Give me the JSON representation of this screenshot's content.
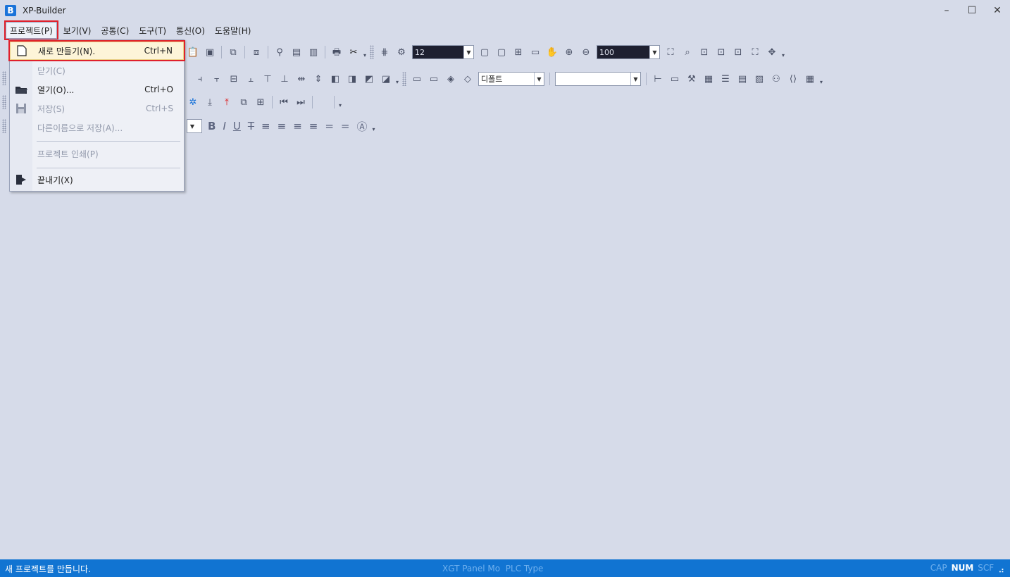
{
  "app": {
    "logo": "B",
    "title": "XP-Builder",
    "window_controls": {
      "minimize": "–",
      "maximize": "☐",
      "close": "✕"
    }
  },
  "menubar": {
    "items": [
      {
        "label": "프로젝트(P)"
      },
      {
        "label": "보기(V)"
      },
      {
        "label": "공통(C)"
      },
      {
        "label": "도구(T)"
      },
      {
        "label": "통신(O)"
      },
      {
        "label": "도움말(H)"
      }
    ]
  },
  "toolbar": {
    "font_size_value": "12",
    "zoom_value": "100",
    "style_combo_value": "디폴트",
    "empty_combo_value": ""
  },
  "project_menu": {
    "items": [
      {
        "label": "새로 만들기(N).",
        "shortcut": "Ctrl+N",
        "icon": "new-file-icon"
      },
      {
        "label": "닫기(C)",
        "shortcut": "",
        "icon": ""
      },
      {
        "label": "열기(O)...",
        "shortcut": "Ctrl+O",
        "icon": "open-folder-icon"
      },
      {
        "label": "저장(S)",
        "shortcut": "Ctrl+S",
        "icon": "save-disk-icon"
      },
      {
        "label": "다른이름으로 저장(A)...",
        "shortcut": "",
        "icon": ""
      },
      {
        "label": "프로젝트 인쇄(P)",
        "shortcut": "",
        "icon": ""
      },
      {
        "label": "끝내기(X)",
        "shortcut": "",
        "icon": "exit-door-icon"
      }
    ]
  },
  "statusbar": {
    "message": "새 프로젝트를 만듭니다.",
    "panel_model": "XGT Panel Mo",
    "plc_type": "PLC Type",
    "cap": "CAP",
    "num": "NUM",
    "scr": "SCF"
  }
}
